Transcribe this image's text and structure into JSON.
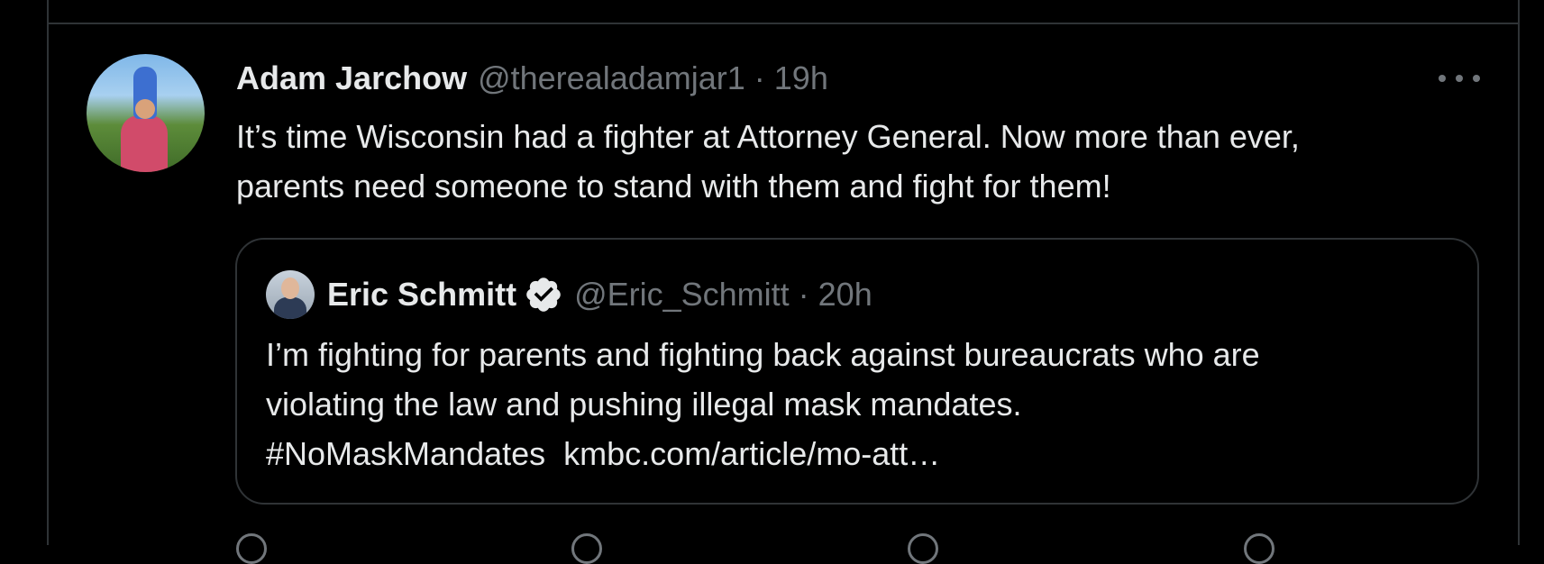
{
  "tweet": {
    "author_name": "Adam Jarchow",
    "author_handle": "@therealadamjar1",
    "separator": "·",
    "time": "19h",
    "text_line1": "It’s time Wisconsin had a fighter at Attorney General. Now more than ever,",
    "text_line2": "parents need someone to stand with them and fight for them!",
    "more_icon": "more-dots-icon"
  },
  "quote": {
    "author_name": "Eric Schmitt",
    "verified_icon": "verified-badge-icon",
    "author_handle": "@Eric_Schmitt",
    "separator": "·",
    "time": "20h",
    "text_line1": "I’m fighting for parents and fighting back against bureaucrats who are",
    "text_line2": "violating the law and pushing illegal mask mandates.",
    "hashtag": "#NoMaskMandates",
    "link": "kmbc.com/article/mo-att…"
  },
  "actions": {
    "icons": [
      "reply-icon",
      "retweet-icon",
      "like-icon",
      "share-icon"
    ]
  },
  "colors": {
    "background": "#000000",
    "text": "#e7e9ea",
    "muted": "#71767b",
    "border": "#2f3336"
  }
}
